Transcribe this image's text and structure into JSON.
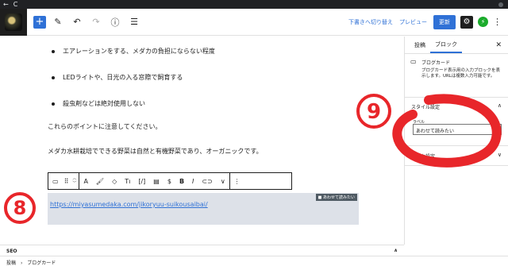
{
  "browser": {
    "back": "←",
    "reload": "C"
  },
  "toolbar": {
    "add": "+",
    "tools_icon": "✎",
    "undo": "↶",
    "redo": "↷",
    "info": "ⓘ",
    "outline": "☰",
    "draft_switch": "下書きへ切り替え",
    "preview": "プレビュー",
    "update": "更新",
    "settings": "⚙",
    "jetpack": "⚡",
    "more": "⋮"
  },
  "content": {
    "bullets": [
      "エアレーションをする、メダカの負担にならない程度",
      "LEDライトや、日光の入る窓際で飼育する",
      "殺虫剤などは絶対使用しない"
    ],
    "para1": "これらのポイントに注意してください。",
    "para2": "メダカ水耕栽培でできる野菜は自然と有機野菜であり、オーガニックです。"
  },
  "block_toolbar": {
    "block_icon": "▭",
    "drag": "⠿",
    "up": "︿",
    "down": "﹀",
    "text": "A",
    "brush": "🖌",
    "tag": "◇",
    "size": "Tı",
    "shortcode": "[/]",
    "doc": "▤",
    "dollar": "$",
    "bold": "B",
    "italic": "I",
    "link": "⊂⊃",
    "dropdown": "∨",
    "more": "⋮"
  },
  "link_block": {
    "url": "https://miyasumedaka.com/jikoryuu-suikousaibai/",
    "tag": "■ あわせて読みたい"
  },
  "annotations": {
    "eight": "8",
    "nine": "9"
  },
  "sidebar": {
    "tabs": [
      "投稿",
      "ブロック"
    ],
    "close": "✕",
    "block_icon": "▭",
    "block_title": "ブログカード",
    "block_desc": "ブログカード表示用の入力ブロックを表示します。URLは複数入力可能です。",
    "style_heading": "スタイル設定",
    "label_caption": "ラベル",
    "label_value": "あわせて読みたい",
    "advanced_heading": "高度な設定",
    "up_arrow": "∧",
    "down_arrow": "∨"
  },
  "seo": {
    "label": "SEO",
    "arrow": "∧"
  },
  "breadcrumb": {
    "root": "投稿",
    "sep": "›",
    "current": "ブログカード"
  },
  "colors": {
    "accent": "#2f71d6",
    "annotation": "#e8262a",
    "link_bg": "#dde1e8"
  }
}
